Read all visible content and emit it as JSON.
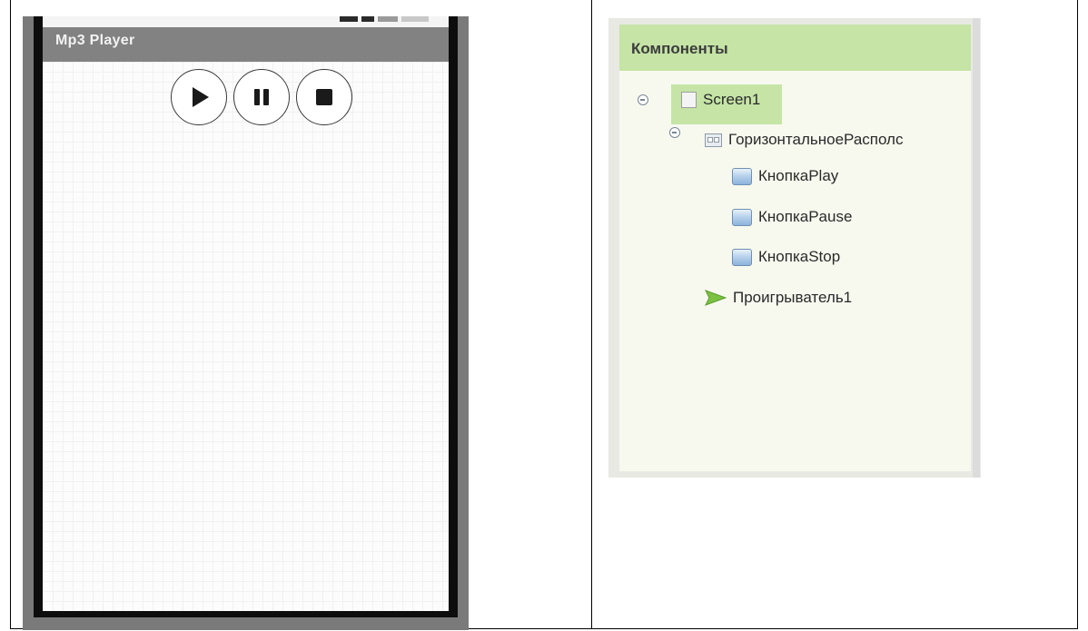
{
  "phone": {
    "app_title": "Mp3 Player",
    "buttons": [
      {
        "name": "play",
        "icon": "play-icon"
      },
      {
        "name": "pause",
        "icon": "pause-icon"
      },
      {
        "name": "stop",
        "icon": "stop-icon"
      }
    ]
  },
  "components": {
    "header": "Компоненты",
    "tree": {
      "screen": "Screen1",
      "layout": "ГоризонтальноеРасполс",
      "button_play": "КнопкаPlay",
      "button_pause": "КнопкаPause",
      "button_stop": "КнопкаStop",
      "player": "Проигрыватель1"
    }
  },
  "colors": {
    "header_green": "#c5e4a6",
    "selection_green": "#c5e4a6",
    "titlebar_gray": "#828282",
    "player_icon_green": "#7cc242"
  }
}
